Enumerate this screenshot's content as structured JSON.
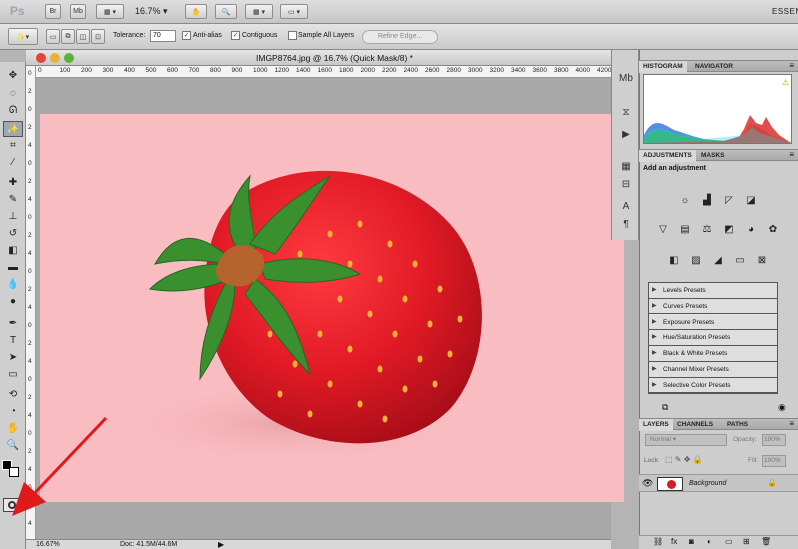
{
  "app": {
    "logo": "Ps",
    "bridge_btn": "Br",
    "minibridge_btn": "Mb",
    "zoom": "16.7%",
    "workspace": "ESSEN"
  },
  "options": {
    "tolerance_label": "Tolerance:",
    "tolerance_value": "70",
    "antialias_label": "Anti-alias",
    "contiguous_label": "Contiguous",
    "sample_label": "Sample All Layers",
    "refine_label": "Refine Edge..."
  },
  "document": {
    "title": "IMGP8764.jpg @ 16.7% (Quick Mask/8) *",
    "ruler_h": [
      "0",
      "100",
      "200",
      "300",
      "400",
      "500",
      "600",
      "700",
      "800",
      "900",
      "1000",
      "1200",
      "1400",
      "1600",
      "1800",
      "2000",
      "2200",
      "2400",
      "2600",
      "2800",
      "3000",
      "3200",
      "3400",
      "3600",
      "3800",
      "4000",
      "4200"
    ],
    "ruler_v": [
      "0",
      "2",
      "0",
      "2",
      "4",
      "0",
      "2",
      "4",
      "0",
      "2",
      "4",
      "0",
      "2",
      "4",
      "0",
      "2",
      "4",
      "0",
      "2",
      "4",
      "0",
      "2",
      "4",
      "0",
      "2",
      "4"
    ],
    "status_zoom": "16.67%",
    "status_doc": "Doc: 41.5M/44.6M"
  },
  "panels": {
    "histogram_tab": "HISTOGRAM",
    "navigator_tab": "NAVIGATOR",
    "adjustments_tab": "ADJUSTMENTS",
    "masks_tab": "MASKS",
    "add_adjustment": "Add an adjustment",
    "presets": [
      "Levels Presets",
      "Curves Presets",
      "Exposure Presets",
      "Hue/Saturation Presets",
      "Black & White Presets",
      "Channel Mixer Presets",
      "Selective Color Presets"
    ],
    "layers_tab": "LAYERS",
    "channels_tab": "CHANNELS",
    "paths_tab": "PATHS",
    "blend_mode": "Normal",
    "opacity_label": "Opacity:",
    "opacity_value": "100%",
    "lock_label": "Lock:",
    "fill_label": "Fill:",
    "fill_value": "100%",
    "layer_name": "Background"
  },
  "colors": {
    "photo_bg": "#f9bcc0",
    "strawberry": "#e01b26",
    "leaves": "#3a8f2f",
    "arrow": "#e0191b"
  }
}
